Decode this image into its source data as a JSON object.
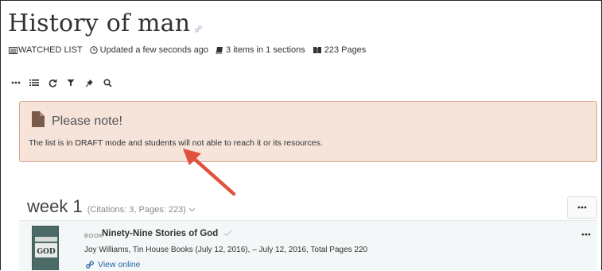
{
  "page": {
    "title": "History of man",
    "title_icon": "link-icon"
  },
  "meta": {
    "watched": "WATCHED LIST",
    "updated": "Updated a few seconds ago",
    "items": "3 items in 1 sections",
    "pages": "223 Pages"
  },
  "toolbar": {
    "icons": [
      "more-icon",
      "list-icon",
      "refresh-icon",
      "filter-icon",
      "pin-icon",
      "search-icon"
    ]
  },
  "notice": {
    "title": "Please note!",
    "text": "The list is in DRAFT mode and students will not able to reach it or its resources.",
    "color_bg": "#f6e3da",
    "color_border": "#d9a48f",
    "icon": "file-icon"
  },
  "section": {
    "title": "week 1",
    "meta": "(Citations: 3, Pages: 223)",
    "menu": "•••"
  },
  "item": {
    "type": "BOOK",
    "title": "Ninety-Nine Stories of God",
    "details": "Joy Williams, Tin House Books (July 12, 2016), – July 12, 2016, Total Pages 220",
    "link": "View online",
    "menu": "•••",
    "cover_text": "GOD"
  },
  "annotation": {
    "arrow_color": "#e0523f"
  }
}
